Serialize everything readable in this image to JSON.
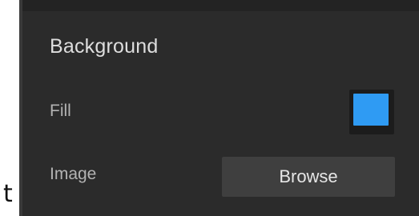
{
  "stray_glyph": "t",
  "panel": {
    "section_title": "Background",
    "fill": {
      "label": "Fill",
      "color": "#2f9bf3"
    },
    "image": {
      "label": "Image",
      "button_label": "Browse"
    }
  }
}
